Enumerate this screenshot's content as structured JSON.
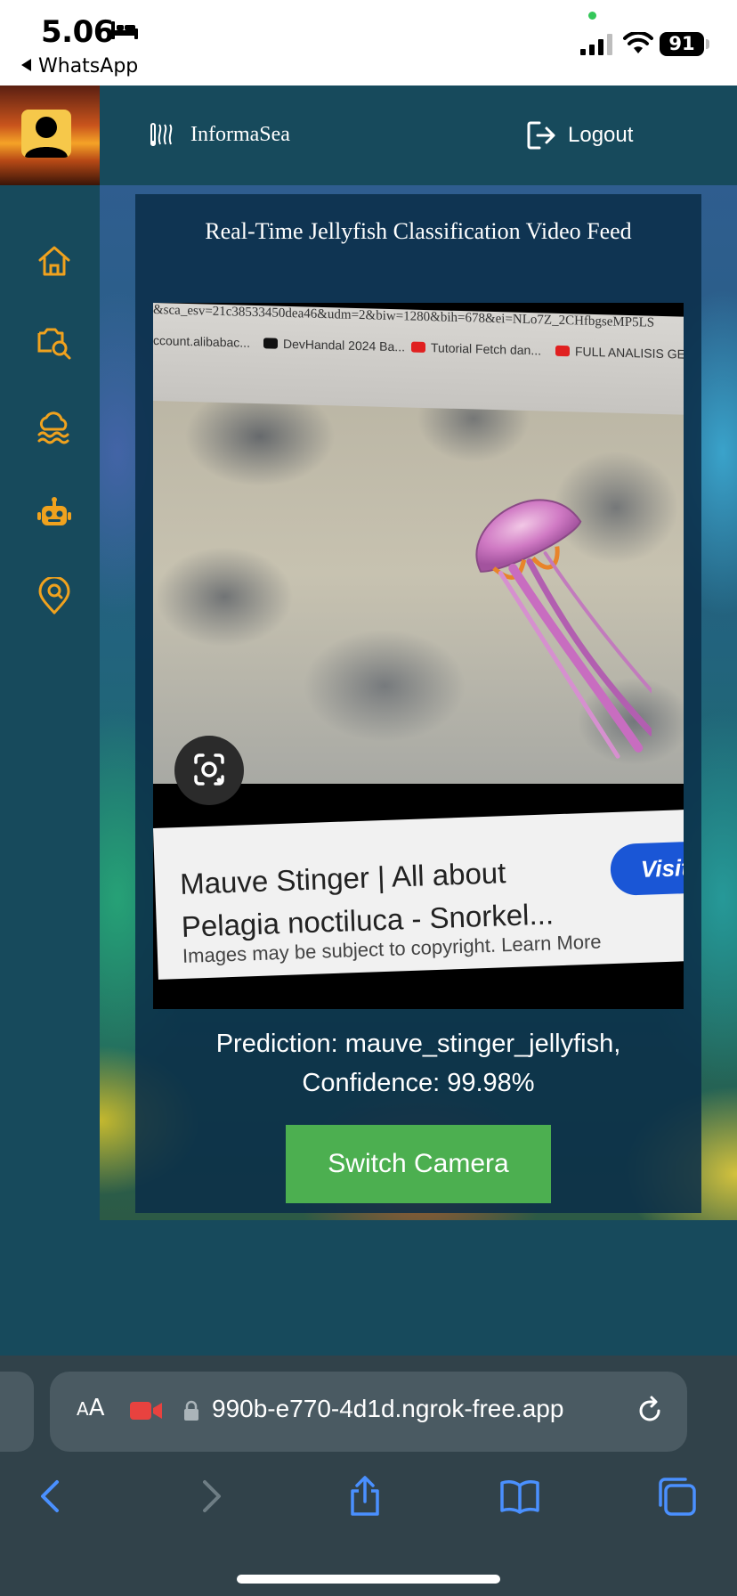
{
  "status_bar": {
    "time": "5.06",
    "back_app": "WhatsApp",
    "battery": "91"
  },
  "header": {
    "brand": "InformaSea",
    "logout_label": "Logout"
  },
  "sidebar": {
    "items": [
      {
        "name": "home",
        "icon": "home-icon"
      },
      {
        "name": "image-search",
        "icon": "image-search-icon"
      },
      {
        "name": "weather",
        "icon": "cloud-waves-icon"
      },
      {
        "name": "chatbot",
        "icon": "robot-icon"
      },
      {
        "name": "location-search",
        "icon": "location-search-icon"
      }
    ],
    "icon_color": "#f0a21e"
  },
  "main": {
    "title": "Real-Time Jellyfish Classification Video Feed",
    "video": {
      "browser_url": "&sca_esv=21c38533450dea46&udm=2&biw=1280&bih=678&ei=NLo7Z_2CHfbgseMP5LS",
      "bookmarks": [
        "ccount.alibabac...",
        "DevHandal 2024 Ba...",
        "Tutorial Fetch dan...",
        "FULL ANALISIS GEL..."
      ],
      "card_title": "Mauve Stinger | All about Pelagia noctiluca - Snorkel...",
      "card_button": "Visit",
      "card_note": "Images may be subject to copyright. Learn More"
    },
    "prediction_line1": "Prediction: mauve_stinger_jellyfish,",
    "prediction_line2": "Confidence: 99.98%",
    "switch_camera_label": "Switch Camera",
    "button_color": "#4caf50"
  },
  "browser": {
    "text_size": "AA",
    "url": "990b-e770-4d1d.ngrok-free.app"
  }
}
